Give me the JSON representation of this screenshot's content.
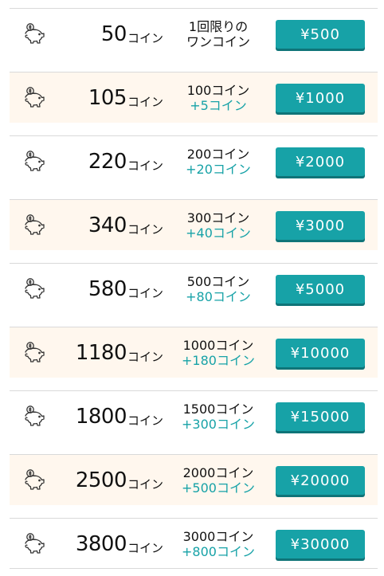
{
  "coin_unit": "コイン",
  "offers": [
    {
      "coins": "50",
      "line1": "1回限りの",
      "line2": "ワンコイン",
      "line2_style": "base",
      "price": "¥500",
      "highlight": false
    },
    {
      "coins": "105",
      "line1": "100コイン",
      "line2": "+5コイン",
      "line2_style": "bonus",
      "price": "¥1000",
      "highlight": true
    },
    {
      "coins": "220",
      "line1": "200コイン",
      "line2": "+20コイン",
      "line2_style": "bonus",
      "price": "¥2000",
      "highlight": false
    },
    {
      "coins": "340",
      "line1": "300コイン",
      "line2": "+40コイン",
      "line2_style": "bonus",
      "price": "¥3000",
      "highlight": true
    },
    {
      "coins": "580",
      "line1": "500コイン",
      "line2": "+80コイン",
      "line2_style": "bonus",
      "price": "¥5000",
      "highlight": false
    },
    {
      "coins": "1180",
      "line1": "1000コイン",
      "line2": "+180コイン",
      "line2_style": "bonus",
      "price": "¥10000",
      "highlight": true
    },
    {
      "coins": "1800",
      "line1": "1500コイン",
      "line2": "+300コイン",
      "line2_style": "bonus",
      "price": "¥15000",
      "highlight": false
    },
    {
      "coins": "2500",
      "line1": "2000コイン",
      "line2": "+500コイン",
      "line2_style": "bonus",
      "price": "¥20000",
      "highlight": true
    },
    {
      "coins": "3800",
      "line1": "3000コイン",
      "line2": "+800コイン",
      "line2_style": "bonus",
      "price": "¥30000",
      "highlight": false
    }
  ],
  "icons": {
    "row_icon": "piggy-bank-icon"
  },
  "colors": {
    "accent": "#17a2a7",
    "accent_shadow": "#0f7478",
    "highlight_bg": "#fff7ee",
    "divider": "#d9d9d9"
  }
}
